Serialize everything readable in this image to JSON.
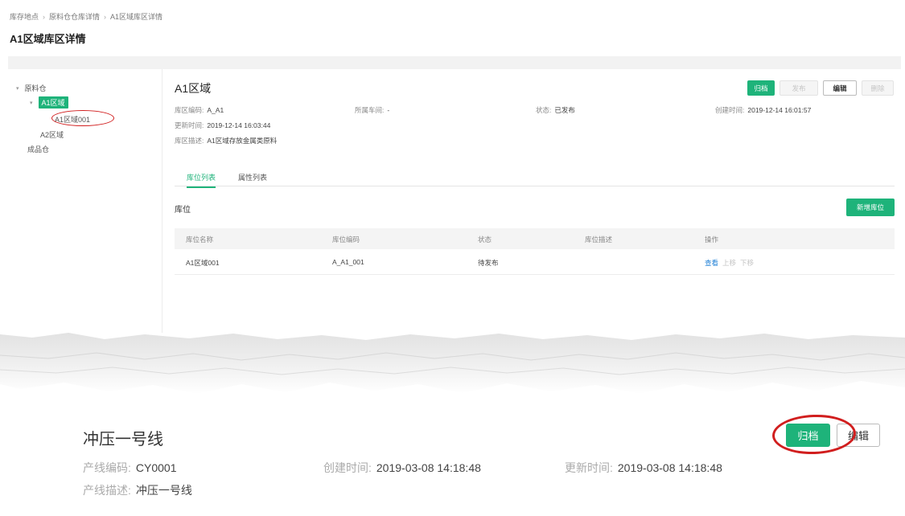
{
  "breadcrumb": [
    "库存地点",
    "原料仓仓库详情",
    "A1区域库区详情"
  ],
  "breadcrumb_sep": "›",
  "page_title": "A1区域库区详情",
  "tree": {
    "caret_glyph": "▾",
    "root1": "原料仓",
    "child_active": "A1区域",
    "grandchild": "A1区域001",
    "child2": "A2区域",
    "root2": "成品仓"
  },
  "area": {
    "title": "A1区域",
    "code_label": "库区编码:",
    "code_value": "A_A1",
    "workshop_label": "所属车间:",
    "workshop_value": "-",
    "status_label": "状态:",
    "status_value": "已发布",
    "created_label": "创建时间:",
    "created_value": "2019-12-14 16:01:57",
    "updated_label": "更新时间:",
    "updated_value": "2019-12-14 16:03:44",
    "desc_label": "库区描述:",
    "desc_value": "A1区域存放金属类原料"
  },
  "actions": {
    "archive": "归档",
    "publish": "发布",
    "edit": "编辑",
    "delete": "删除"
  },
  "tabs": [
    "库位列表",
    "属性列表"
  ],
  "section_title": "库位",
  "add_button": "新增库位",
  "table": {
    "headers": [
      "库位名称",
      "库位编码",
      "状态",
      "库位描述",
      "操作"
    ],
    "rows": [
      {
        "name": "A1区域001",
        "code": "A_A1_001",
        "status": "待发布",
        "desc": "",
        "op_view": "查看",
        "op_up": "上移",
        "op_down": "下移"
      }
    ]
  },
  "bottom": {
    "title": "冲压一号线",
    "code_label": "产线编码:",
    "code_value": "CY0001",
    "created_label": "创建时间:",
    "created_value": "2019-03-08 14:18:48",
    "updated_label": "更新时间:",
    "updated_value": "2019-03-08 14:18:48",
    "desc_label": "产线描述:",
    "desc_value": "冲压一号线",
    "archive": "归档",
    "edit": "编辑"
  },
  "colors": {
    "accent": "#1eb37a",
    "link": "#1e7fd6",
    "annotation": "#d11e1e"
  }
}
